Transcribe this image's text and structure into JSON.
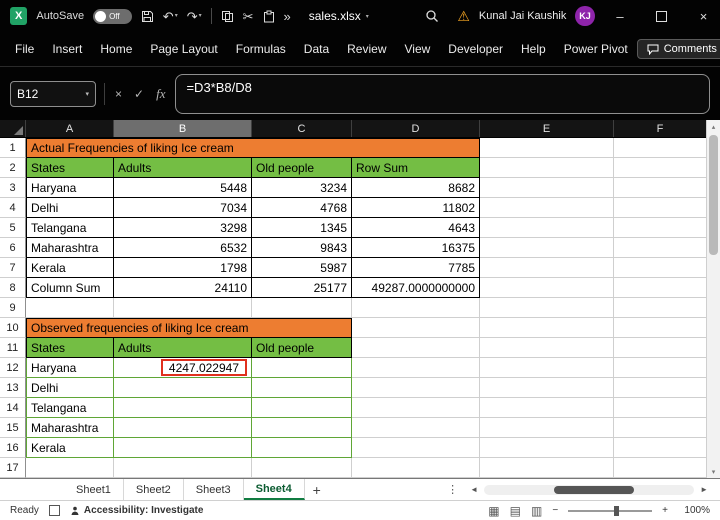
{
  "colors": {
    "excel_brand_green": "#21A366",
    "accent_green": "#107C41",
    "banner_orange": "#ED7D31",
    "header_fill_green": "#74BE44",
    "table_border_green": "#5FA636",
    "annotation_red": "#E0301E",
    "avatar_purple": "#8E24AA",
    "titlebar_black": "#030303"
  },
  "titlebar": {
    "app_icon": "X",
    "autosave_label": "AutoSave",
    "autosave_state": "Off",
    "filename": "sales.xlsx",
    "user_name": "Kunal Jai Kaushik",
    "user_initials": "KJ"
  },
  "ribbon": {
    "tabs": [
      "File",
      "Insert",
      "Home",
      "Page Layout",
      "Formulas",
      "Data",
      "Review",
      "View",
      "Developer",
      "Help",
      "Power Pivot"
    ],
    "comments_label": "Comments"
  },
  "formula_bar": {
    "name_box": "B12",
    "fx_label": "fx",
    "formula": "=D3*B8/D8"
  },
  "sheet": {
    "col_headers": [
      "A",
      "B",
      "C",
      "D",
      "E",
      "F"
    ],
    "row_numbers": [
      "1",
      "2",
      "3",
      "4",
      "5",
      "6",
      "7",
      "8",
      "9",
      "10",
      "11",
      "12",
      "13",
      "14",
      "15",
      "16",
      "17"
    ],
    "cells": {
      "A1": "Actual Frequencies of liking Ice cream",
      "A2": "States",
      "B2": "Adults",
      "C2": "Old people",
      "D2": "Row Sum",
      "A3": "Haryana",
      "B3": "5448",
      "C3": "3234",
      "D3": "8682",
      "A4": "Delhi",
      "B4": "7034",
      "C4": "4768",
      "D4": "11802",
      "A5": "Telangana",
      "B5": "3298",
      "C5": "1345",
      "D5": "4643",
      "A6": "Maharashtra",
      "B6": "6532",
      "C6": "9843",
      "D6": "16375",
      "A7": "Kerala",
      "B7": "1798",
      "C7": "5987",
      "D7": "7785",
      "A8": "Column Sum",
      "B8": "24110",
      "C8": "25177",
      "D8": "49287.0000000000",
      "A10": "Observed frequencies of liking Ice cream",
      "A11": "States",
      "B11": "Adults",
      "C11": "Old people",
      "A12": "Haryana",
      "B12": "4247.022947",
      "A13": "Delhi",
      "A14": "Telangana",
      "A15": "Maharashtra",
      "A16": "Kerala"
    }
  },
  "sheet_tabs": {
    "tabs": [
      "Sheet1",
      "Sheet2",
      "Sheet3",
      "Sheet4"
    ],
    "active": "Sheet4"
  },
  "status_bar": {
    "mode": "Ready",
    "accessibility": "Accessibility: Investigate",
    "zoom": "100%"
  }
}
